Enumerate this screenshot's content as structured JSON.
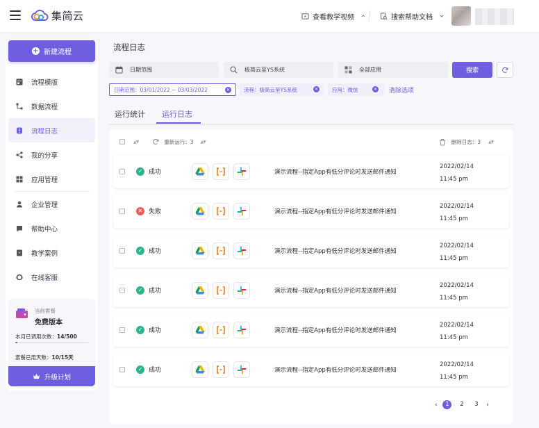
{
  "app": {
    "name": "集简云"
  },
  "topbar": {
    "tutorial_label": "查看教学视频",
    "help_label": "搜索帮助文档"
  },
  "sidebar": {
    "new_flow_label": "新建流程",
    "items": [
      {
        "label": "流程模版",
        "icon": "template-icon"
      },
      {
        "label": "数据流程",
        "icon": "flow-icon"
      },
      {
        "label": "流程日志",
        "icon": "log-icon",
        "active": true
      },
      {
        "label": "我的分享",
        "icon": "share-icon"
      },
      {
        "label": "应用管理",
        "icon": "apps-icon"
      },
      {
        "label": "企业管理",
        "icon": "user-icon"
      },
      {
        "label": "帮助中心",
        "icon": "help-icon"
      },
      {
        "label": "教学案例",
        "icon": "case-icon"
      },
      {
        "label": "在线客服",
        "icon": "support-icon"
      }
    ],
    "plan": {
      "label": "当前套餐",
      "name": "免费版本",
      "calls_label": "本月已调用次数：",
      "calls_value": "14/500",
      "calls_fraction": 0.028,
      "days_label": "套餐已用天数：",
      "days_value": "10/15天",
      "upgrade_label": "升级计划"
    }
  },
  "main": {
    "title": "流程日志",
    "filters": {
      "date_placeholder": "日期范围",
      "flow_value": "极简云至YS系统",
      "app_value": "全部应用",
      "search_label": "搜索"
    },
    "chips": [
      {
        "key": "日期范围：",
        "value": "03/01/2022 ~ 03/03/2022"
      },
      {
        "key": "流程：",
        "value": "极简云至YS系统"
      },
      {
        "key": "应用：",
        "value": "微信"
      }
    ],
    "clear_label": "清除选项",
    "tabs": [
      "运行统计",
      "运行日志"
    ],
    "active_tab": 1,
    "table": {
      "rerun_label": "重新运行：3",
      "delete_label": "删除日志：3",
      "rows": [
        {
          "status": "成功",
          "ok": true,
          "desc": "演示流程--指定App有低分评论时发送邮件通知",
          "date": "2022/02/14",
          "time": "11:45 pm"
        },
        {
          "status": "失败",
          "ok": false,
          "desc": "演示流程--指定App有低分评论时发送邮件通知",
          "date": "2022/02/14",
          "time": "11:45 pm"
        },
        {
          "status": "成功",
          "ok": true,
          "desc": "演示流程--指定App有低分评论时发送邮件通知",
          "date": "2022/02/14",
          "time": "11:45 pm"
        },
        {
          "status": "成功",
          "ok": true,
          "desc": "演示流程--指定App有低分评论时发送邮件通知",
          "date": "2022/02/14",
          "time": "11:45 pm"
        },
        {
          "status": "成功",
          "ok": true,
          "desc": "演示流程--指定App有低分评论时发送邮件通知",
          "date": "2022/02/14",
          "time": "11:45 pm"
        },
        {
          "status": "成功",
          "ok": true,
          "desc": "演示流程--指定App有低分评论时发送邮件通知",
          "date": "2022/02/14",
          "time": "11:45 pm"
        }
      ]
    },
    "pagination": {
      "pages": [
        "1",
        "2",
        "3"
      ],
      "current": 0
    }
  },
  "colors": {
    "accent": "#6d5fe0",
    "success": "#2bb58e",
    "danger": "#ef5a5a"
  }
}
